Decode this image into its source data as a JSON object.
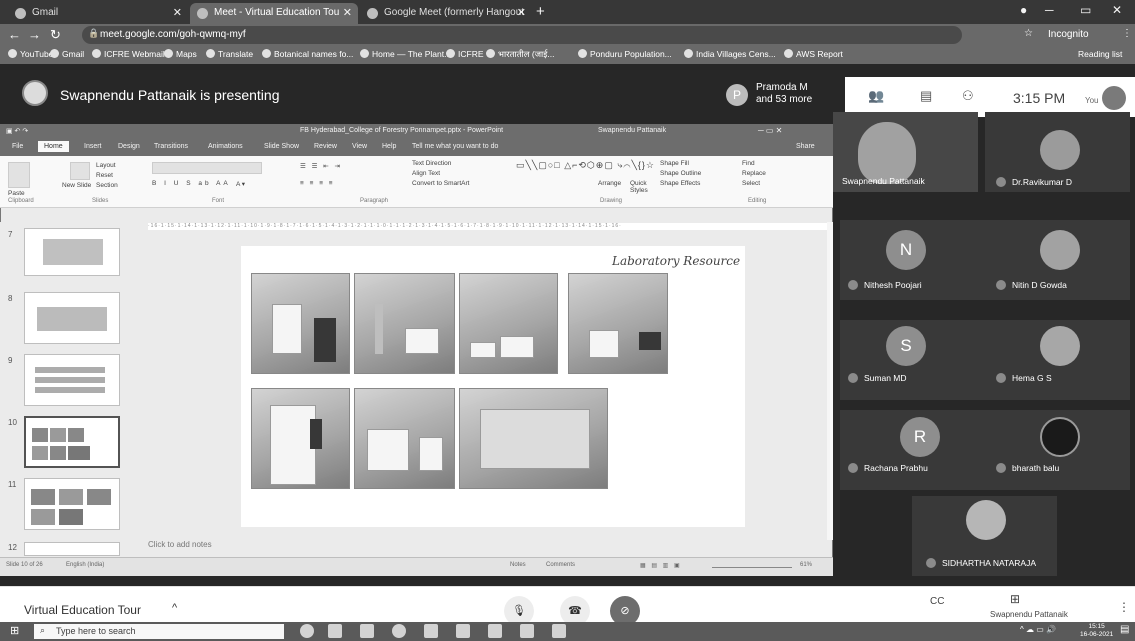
{
  "browser": {
    "tabs": [
      {
        "label": "Gmail",
        "active": false
      },
      {
        "label": "Meet - Virtual Education Tou",
        "active": true
      },
      {
        "label": "Google Meet (formerly Hangout",
        "active": false
      }
    ],
    "url": "meet.google.com/goh-qwmq-myf",
    "incognito_label": "Incognito",
    "bookmarks": [
      "YouTube",
      "Gmail",
      "ICFRE Webmail",
      "Maps",
      "Translate",
      "Botanical names fo...",
      "Home — The Plant...",
      "ICFRE",
      "भारतातील (जाई...",
      "Ponduru Population...",
      "India Villages Cens...",
      "AWS Report",
      "Reading list"
    ]
  },
  "meet": {
    "presenting_text": "Swapnendu Pattanaik is presenting",
    "participants_avatar": "P",
    "participants_text": "Pramoda M and 53 more",
    "time": "3:15 PM",
    "you_label": "You",
    "participants": [
      {
        "name": "Swapnendu Pattanaik",
        "initial": "",
        "video": true
      },
      {
        "name": "Dr.Ravikumar D",
        "initial": "",
        "video": false
      },
      {
        "name": "Nithesh Poojari",
        "initial": "N",
        "video": false
      },
      {
        "name": "Nitin D Gowda",
        "initial": "",
        "video": false
      },
      {
        "name": "Suman MD",
        "initial": "S",
        "video": false
      },
      {
        "name": "Hema G S",
        "initial": "",
        "video": false
      },
      {
        "name": "Rachana Prabhu",
        "initial": "R",
        "video": false
      },
      {
        "name": "bharath balu",
        "initial": "",
        "video": false
      },
      {
        "name": "SIDHARTHA NATARAJA",
        "initial": "",
        "video": false
      }
    ],
    "meeting_name": "Virtual Education Tour",
    "present_label": "Swapnendu Pattanaik"
  },
  "ppt": {
    "title": "FB Hyderabad_College of Forestry Ponnampet.pptx - PowerPoint",
    "user": "Swapnendu Pattanaik",
    "tabs": [
      "File",
      "Home",
      "Insert",
      "Design",
      "Transitions",
      "Animations",
      "Slide Show",
      "Review",
      "View",
      "Help",
      "Tell me what you want to do"
    ],
    "share_label": "Share",
    "ribbon": {
      "paste": "Paste",
      "new_slide": "New Slide",
      "layout": "Layout",
      "reset": "Reset",
      "section": "Section",
      "text_direction": "Text Direction",
      "align_text": "Align Text",
      "convert_smartart": "Convert to SmartArt",
      "arrange": "Arrange",
      "quick_styles": "Quick Styles",
      "shape_fill": "Shape Fill",
      "shape_outline": "Shape Outline",
      "shape_effects": "Shape Effects",
      "find": "Find",
      "replace": "Replace",
      "select": "Select"
    },
    "groups": [
      "Clipboard",
      "Slides",
      "Font",
      "Paragraph",
      "Drawing",
      "Editing"
    ],
    "slide_numbers": [
      "7",
      "8",
      "9",
      "10",
      "11",
      "12"
    ],
    "slide_title": "Laboratory Resource",
    "notes_placeholder": "Click to add notes",
    "status_slide": "Slide 10 of 26",
    "status_lang": "English (India)",
    "status_notes": "Notes",
    "status_comments": "Comments",
    "zoom": "61%"
  },
  "taskbar": {
    "search_placeholder": "Type here to search",
    "time": "15:15",
    "date": "16-06-2021"
  }
}
